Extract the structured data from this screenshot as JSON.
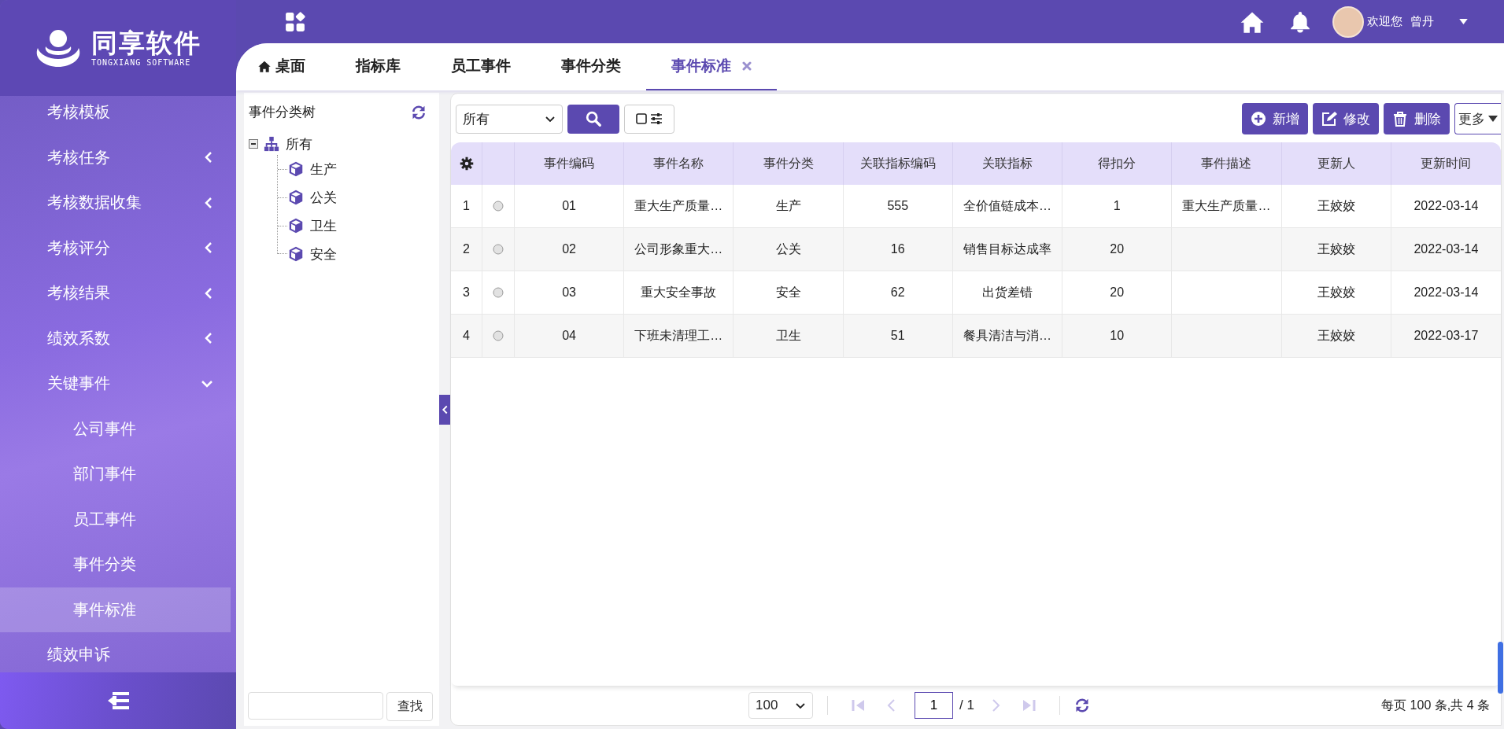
{
  "logo": {
    "name": "同享软件",
    "tagline": "TONGXIANG SOFTWARE"
  },
  "sidebar": {
    "items": [
      {
        "label": "考核模板",
        "kind": "link",
        "selected": false
      },
      {
        "label": "考核任务",
        "kind": "group",
        "expanded": false,
        "selected": false
      },
      {
        "label": "考核数据收集",
        "kind": "group",
        "expanded": false,
        "selected": false
      },
      {
        "label": "考核评分",
        "kind": "group",
        "expanded": false,
        "selected": false
      },
      {
        "label": "考核结果",
        "kind": "group",
        "expanded": false,
        "selected": false
      },
      {
        "label": "绩效系数",
        "kind": "group",
        "expanded": false,
        "selected": false
      },
      {
        "label": "关键事件",
        "kind": "group",
        "expanded": true,
        "selected": false,
        "children": [
          {
            "label": "公司事件",
            "selected": false
          },
          {
            "label": "部门事件",
            "selected": false
          },
          {
            "label": "员工事件",
            "selected": false
          },
          {
            "label": "事件分类",
            "selected": false
          },
          {
            "label": "事件标准",
            "selected": true
          }
        ]
      },
      {
        "label": "绩效申诉",
        "kind": "link",
        "selected": false
      }
    ]
  },
  "header": {
    "greeting": "欢迎您",
    "user": "曾丹"
  },
  "tabs": [
    {
      "label": "桌面",
      "kind": "home",
      "selected": false,
      "closable": false
    },
    {
      "label": "指标库",
      "kind": "page",
      "selected": false,
      "closable": false
    },
    {
      "label": "员工事件",
      "kind": "page",
      "selected": false,
      "closable": false
    },
    {
      "label": "事件分类",
      "kind": "page",
      "selected": false,
      "closable": false
    },
    {
      "label": "事件标准",
      "kind": "page",
      "selected": true,
      "closable": true
    }
  ],
  "tree": {
    "title": "事件分类树",
    "root": {
      "label": "所有",
      "expanded": true,
      "children": [
        {
          "label": "生产"
        },
        {
          "label": "公关"
        },
        {
          "label": "卫生"
        },
        {
          "label": "安全"
        }
      ]
    },
    "search_button": "查找"
  },
  "toolbar": {
    "filter": {
      "value": "所有"
    },
    "buttons": [
      {
        "label": "新增",
        "kind": "add"
      },
      {
        "label": "修改",
        "kind": "edit"
      },
      {
        "label": "删除",
        "kind": "delete"
      }
    ],
    "more": "更多"
  },
  "table": {
    "columns": [
      "事件编码",
      "事件名称",
      "事件分类",
      "关联指标编码",
      "关联指标",
      "得扣分",
      "事件描述",
      "更新人",
      "更新时间"
    ],
    "rows": [
      {
        "index": "1",
        "selected": false,
        "cells": [
          "01",
          "重大生产质量…",
          "生产",
          "555",
          "全价值链成本…",
          "1",
          "重大生产质量…",
          "王姣姣",
          "2022-03-14"
        ]
      },
      {
        "index": "2",
        "selected": false,
        "cells": [
          "02",
          "公司形象重大…",
          "公关",
          "16",
          "销售目标达成率",
          "20",
          null,
          "王姣姣",
          "2022-03-14"
        ]
      },
      {
        "index": "3",
        "selected": false,
        "cells": [
          "03",
          "重大安全事故",
          "安全",
          "62",
          "出货差错",
          "20",
          null,
          "王姣姣",
          "2022-03-14"
        ]
      },
      {
        "index": "4",
        "selected": false,
        "cells": [
          "04",
          "下班未清理工…",
          "卫生",
          "51",
          "餐具清洁与消…",
          "10",
          null,
          "王姣姣",
          "2022-03-17"
        ]
      }
    ]
  },
  "pager": {
    "page_size": "100",
    "page": "1",
    "total_pages": "/ 1",
    "nav": [
      {
        "kind": "first",
        "disabled": true
      },
      {
        "kind": "prev",
        "disabled": true
      },
      {
        "kind": "next",
        "disabled": true
      },
      {
        "kind": "last",
        "disabled": true
      }
    ],
    "summary": "每页 100 条,共 4 条"
  }
}
